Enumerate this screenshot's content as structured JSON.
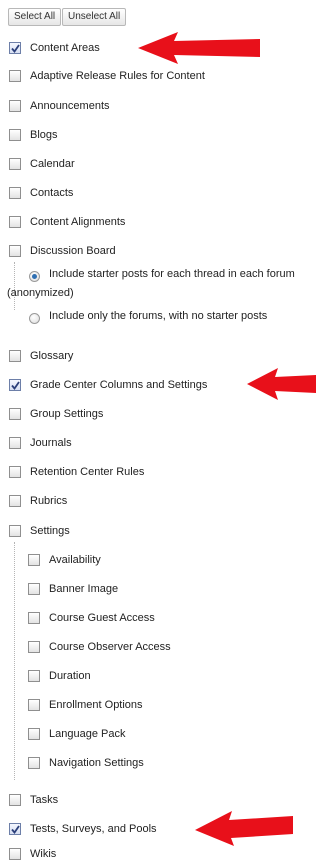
{
  "toolbar": {
    "select_all": "Select All",
    "unselect_all": "Unselect All"
  },
  "items": [
    {
      "label": "Content Areas",
      "checked": true
    },
    {
      "label": "Adaptive Release Rules for Content",
      "checked": false
    },
    {
      "label": "Announcements",
      "checked": false
    },
    {
      "label": "Blogs",
      "checked": false
    },
    {
      "label": "Calendar",
      "checked": false
    },
    {
      "label": "Contacts",
      "checked": false
    },
    {
      "label": "Content Alignments",
      "checked": false
    },
    {
      "label": "Discussion Board",
      "checked": false
    },
    {
      "label": "Glossary",
      "checked": false
    },
    {
      "label": "Grade Center Columns and Settings",
      "checked": true
    },
    {
      "label": "Group Settings",
      "checked": false
    },
    {
      "label": "Journals",
      "checked": false
    },
    {
      "label": "Retention Center Rules",
      "checked": false
    },
    {
      "label": "Rubrics",
      "checked": false
    },
    {
      "label": "Settings",
      "checked": false
    },
    {
      "label": "Tasks",
      "checked": false
    },
    {
      "label": "Tests, Surveys, and Pools",
      "checked": true
    },
    {
      "label": "Wikis",
      "checked": false
    }
  ],
  "discussion_options": [
    {
      "line1": "Include starter posts for each thread in each forum",
      "line2": "(anonymized)",
      "selected": true
    },
    {
      "line1": "Include only the forums, with no starter posts",
      "line2": "",
      "selected": false
    }
  ],
  "settings_subitems": [
    {
      "label": "Availability",
      "checked": false
    },
    {
      "label": "Banner Image",
      "checked": false
    },
    {
      "label": "Course Guest Access",
      "checked": false
    },
    {
      "label": "Course Observer Access",
      "checked": false
    },
    {
      "label": "Duration",
      "checked": false
    },
    {
      "label": "Enrollment Options",
      "checked": false
    },
    {
      "label": "Language Pack",
      "checked": false
    },
    {
      "label": "Navigation Settings",
      "checked": false
    }
  ],
  "colors": {
    "arrow": "#e8101a",
    "radio_selected": "#2f6fb2",
    "check_mark": "#2b3f7a"
  }
}
